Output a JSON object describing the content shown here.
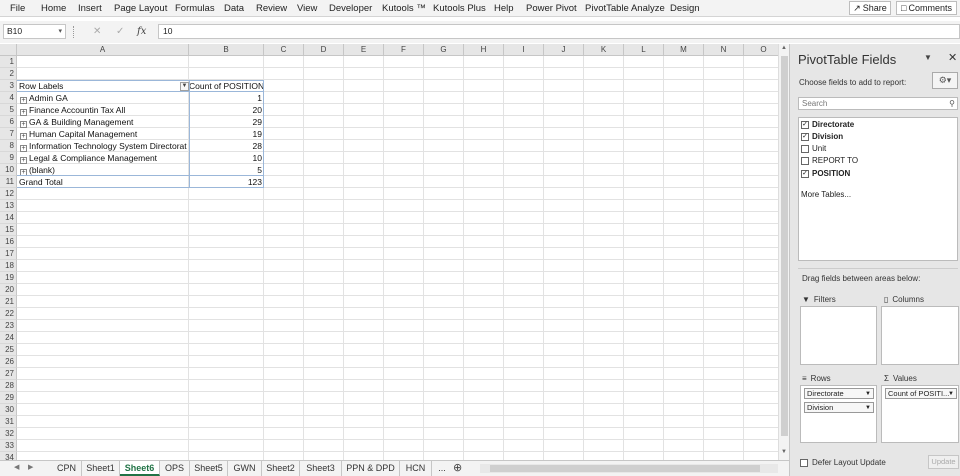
{
  "menu": [
    "File",
    "Home",
    "Insert",
    "Page Layout",
    "Formulas",
    "Data",
    "Review",
    "View",
    "Developer",
    "Kutools ™",
    "Kutools Plus",
    "Help",
    "Power Pivot",
    "PivotTable Analyze",
    "Design"
  ],
  "share_label": "Share",
  "comments_label": "Comments",
  "namebox": "B10",
  "formula_value": "10",
  "columns": [
    "A",
    "B",
    "C",
    "D",
    "E",
    "F",
    "G",
    "H",
    "I",
    "J",
    "K",
    "L",
    "M",
    "N",
    "O"
  ],
  "rows": [
    "1",
    "2",
    "3",
    "4",
    "5",
    "6",
    "7",
    "8",
    "9",
    "10",
    "11",
    "12",
    "13",
    "14",
    "15",
    "16",
    "17",
    "18",
    "19",
    "20",
    "21",
    "22",
    "23",
    "24",
    "25",
    "26",
    "27",
    "28",
    "29",
    "30",
    "31",
    "32",
    "33",
    "34"
  ],
  "pivot": {
    "header_label": "Row Labels",
    "header_value": "Count of POSITION",
    "rows": [
      {
        "label": "Admin GA",
        "value": "1"
      },
      {
        "label": "Finance Accountin Tax All",
        "value": "20"
      },
      {
        "label": "GA & Building Management",
        "value": "29"
      },
      {
        "label": "Human Capital Management",
        "value": "19"
      },
      {
        "label": "Information Technology System Directorat",
        "value": "28"
      },
      {
        "label": "Legal & Compliance Management",
        "value": "10"
      },
      {
        "label": "(blank)",
        "value": "5"
      }
    ],
    "total_label": "Grand Total",
    "total_value": "123"
  },
  "sheet_tabs": [
    "CPN",
    "Sheet1",
    "Sheet6",
    "OPS",
    "Sheet5",
    "GWN",
    "Sheet2",
    "Sheet3",
    "PPN & DPD",
    "HCN",
    "..."
  ],
  "active_tab": "Sheet6",
  "panel": {
    "title": "PivotTable Fields",
    "subtitle": "Choose fields to add to report:",
    "search_placeholder": "Search",
    "fields": [
      {
        "name": "Directorate",
        "checked": true
      },
      {
        "name": "Division",
        "checked": true
      },
      {
        "name": "Unit",
        "checked": false
      },
      {
        "name": "REPORT TO",
        "checked": false
      },
      {
        "name": "POSITION",
        "checked": true
      }
    ],
    "more_tables": "More Tables...",
    "drag_hint": "Drag fields between areas below:",
    "filters_label": "Filters",
    "columns_label": "Columns",
    "rows_label": "Rows",
    "values_label": "Values",
    "rows_items": [
      "Directorate",
      "Division"
    ],
    "values_items": [
      "Count of POSITI..."
    ],
    "defer_label": "Defer Layout Update",
    "update_label": "Update"
  }
}
